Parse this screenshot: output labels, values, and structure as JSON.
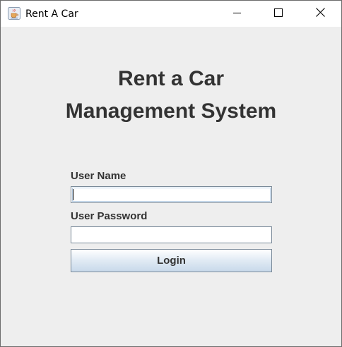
{
  "window": {
    "title": "Rent A Car",
    "app_icon": "java-cup-icon",
    "controls": {
      "minimize_icon": "minimize-icon",
      "maximize_icon": "maximize-icon",
      "close_icon": "close-icon"
    }
  },
  "main": {
    "heading_line1": "Rent a Car",
    "heading_line2": "Management System",
    "user_name_label": "User Name",
    "user_name_value": "",
    "user_password_label": "User Password",
    "user_password_value": "",
    "login_label": "Login"
  },
  "colors": {
    "window_bg": "#eeeeee",
    "titlebar_bg": "#ffffff",
    "text": "#333333",
    "field_border": "#7a8a99",
    "button_gradient_top": "#ffffff",
    "button_gradient_bottom": "#c8d9ea"
  }
}
